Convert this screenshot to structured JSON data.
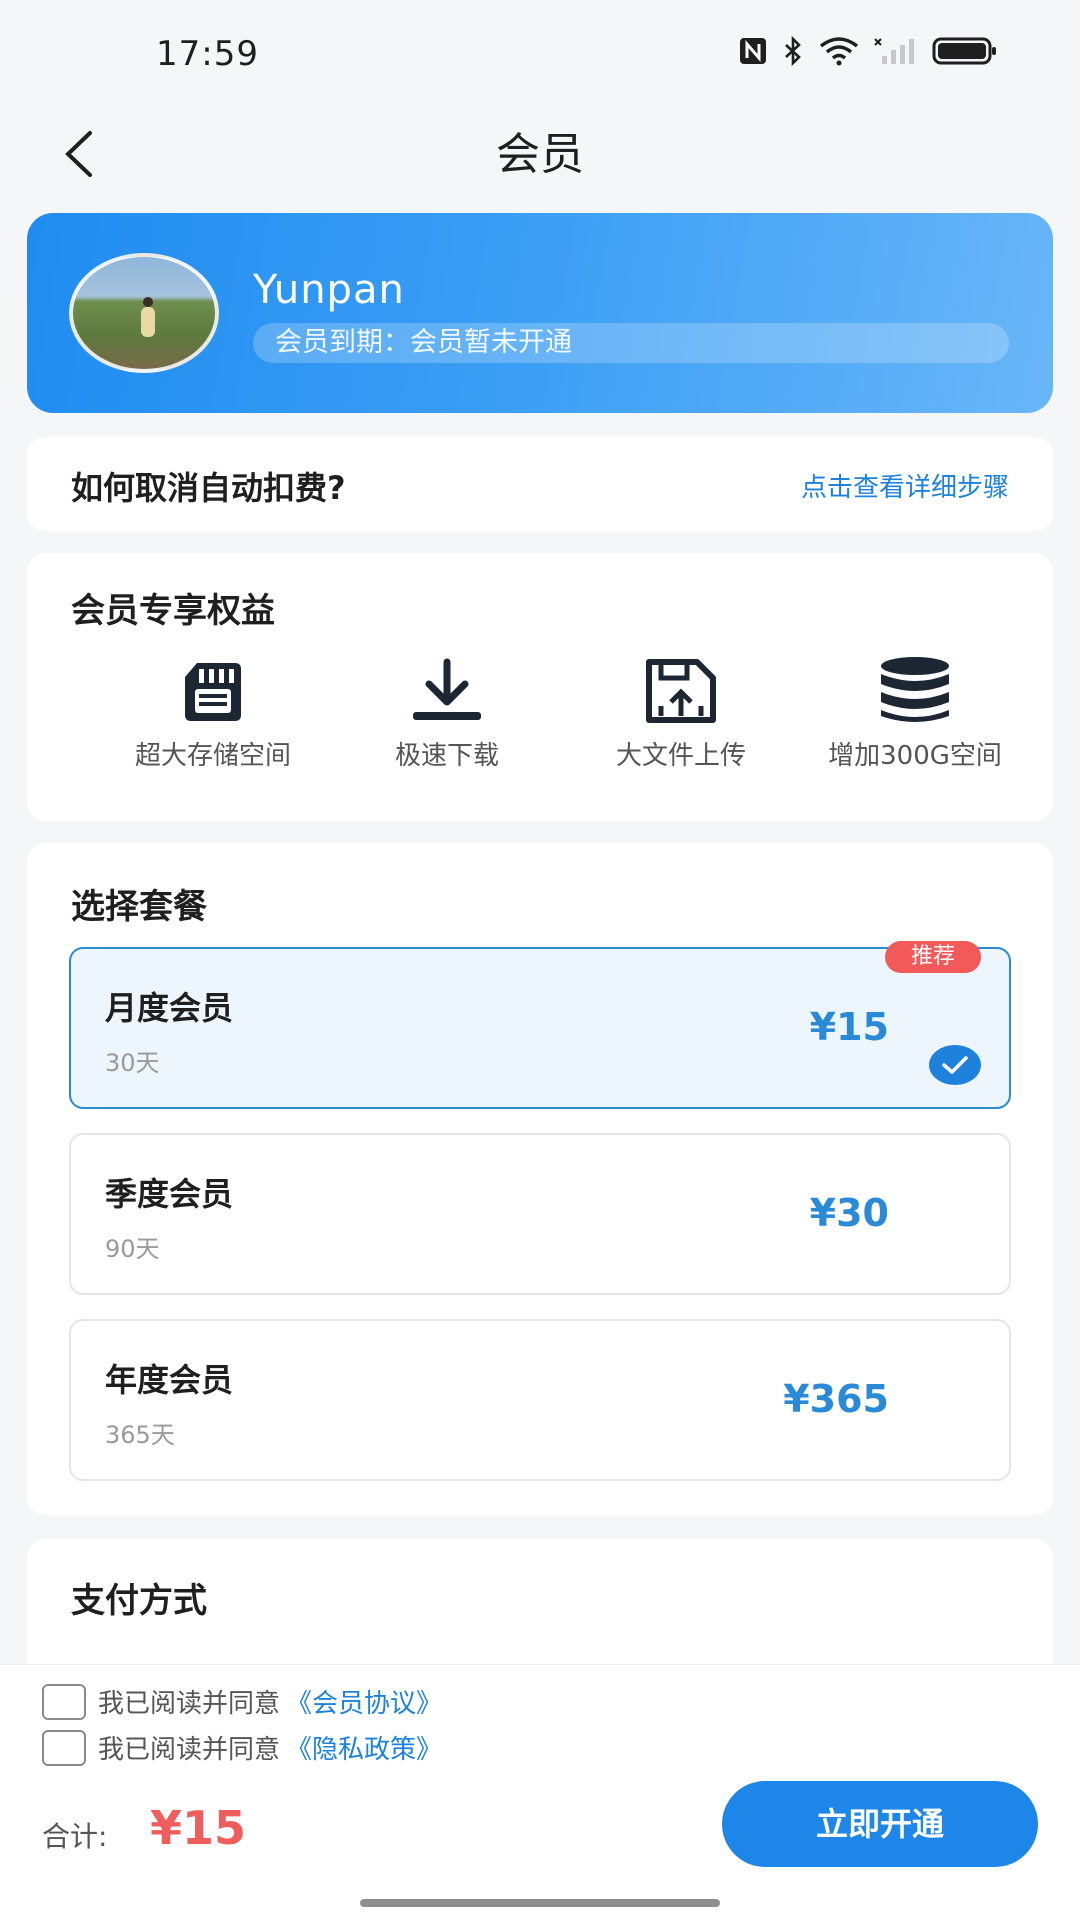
{
  "status_bar": {
    "time": "17:59",
    "icons": [
      "nfc-icon",
      "bluetooth-icon",
      "wifi-icon",
      "signal-icon",
      "battery-icon"
    ]
  },
  "nav": {
    "back_icon": "chevron-left-icon",
    "title": "会员"
  },
  "profile": {
    "name": "Yunpan",
    "expire_text": "会员到期：会员暂未开通"
  },
  "cancel_auto": {
    "question": "如何取消自动扣费?",
    "link": "点击查看详细步骤"
  },
  "benefits": {
    "title": "会员专享权益",
    "items": [
      {
        "label": "超大存储空间",
        "icon": "sd-card-icon"
      },
      {
        "label": "极速下载",
        "icon": "download-icon"
      },
      {
        "label": "大文件上传",
        "icon": "file-upload-icon"
      },
      {
        "label": "增加300G空间",
        "icon": "database-icon"
      }
    ]
  },
  "plans": {
    "title": "选择套餐",
    "items": [
      {
        "name": "月度会员",
        "days": "30天",
        "price": "¥15",
        "badge": "推荐",
        "selected": true
      },
      {
        "name": "季度会员",
        "days": "90天",
        "price": "¥30",
        "selected": false
      },
      {
        "name": "年度会员",
        "days": "365天",
        "price": "¥365",
        "selected": false
      }
    ]
  },
  "payment": {
    "title": "支付方式"
  },
  "agreements": [
    {
      "text": "我已阅读并同意",
      "link": "《会员协议》"
    },
    {
      "text": "我已阅读并同意",
      "link": "《隐私政策》"
    }
  ],
  "footer": {
    "total_label": "合计:",
    "total_value": "¥15",
    "pay_button": "立即开通"
  },
  "colors": {
    "accent": "#1e82dc",
    "price_red": "#f05d5d",
    "badge_red": "#f25a5a"
  }
}
